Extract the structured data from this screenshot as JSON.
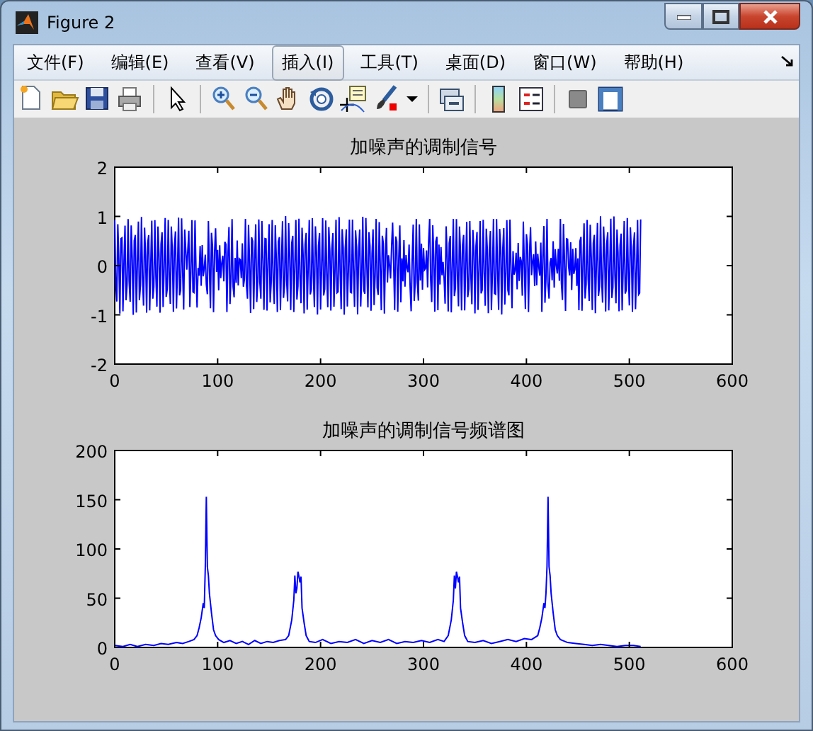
{
  "window": {
    "title": "Figure 2"
  },
  "menu": [
    {
      "label": "文件(F)",
      "selected": false
    },
    {
      "label": "编辑(E)",
      "selected": false
    },
    {
      "label": "查看(V)",
      "selected": false
    },
    {
      "label": "插入(I)",
      "selected": true
    },
    {
      "label": "工具(T)",
      "selected": false
    },
    {
      "label": "桌面(D)",
      "selected": false
    },
    {
      "label": "窗口(W)",
      "selected": false
    },
    {
      "label": "帮助(H)",
      "selected": false
    }
  ],
  "axes": [
    {
      "title": "加噪声的调制信号",
      "kind": "signal",
      "xticks": [
        "0",
        "100",
        "200",
        "300",
        "400",
        "500",
        "600"
      ],
      "yticks": [
        "2",
        "1",
        "0",
        "-1",
        "-2"
      ]
    },
    {
      "kind": "spectrum",
      "chart_data": {
        "type": "line",
        "title": "加噪声的调制信号频谱图",
        "xlim": [
          0,
          600
        ],
        "ylim": [
          0,
          200
        ],
        "xticks": [
          0,
          100,
          200,
          300,
          400,
          500,
          600
        ],
        "yticks": [
          0,
          50,
          100,
          150,
          200
        ],
        "x": [
          0,
          8,
          15,
          22,
          30,
          38,
          45,
          52,
          60,
          66,
          72,
          77,
          80,
          82,
          84,
          86,
          87,
          88,
          89,
          90,
          91,
          92,
          94,
          96,
          98,
          101,
          106,
          112,
          118,
          124,
          130,
          136,
          142,
          148,
          154,
          160,
          166,
          169,
          172,
          174,
          175,
          176,
          177,
          178,
          179,
          180,
          181,
          182,
          184,
          186,
          189,
          195,
          202,
          210,
          218,
          226,
          234,
          242,
          250,
          258,
          266,
          274,
          282,
          290,
          298,
          306,
          314,
          320,
          324,
          327,
          329,
          330,
          331,
          332,
          333,
          334,
          335,
          336,
          338,
          340,
          343,
          350,
          358,
          366,
          374,
          382,
          390,
          398,
          405,
          411,
          413,
          415,
          417,
          418,
          419,
          420,
          421,
          422,
          423,
          424,
          426,
          428,
          430,
          433,
          440,
          448,
          456,
          464,
          472,
          480,
          488,
          496,
          504,
          511
        ],
        "series": [
          {
            "color": "#0000ff",
            "values": [
              2,
              1,
              3,
              1,
              3,
              2,
              4,
              3,
              5,
              4,
              6,
              8,
              12,
              20,
              30,
              45,
              40,
              82,
              153,
              82,
              73,
              55,
              35,
              18,
              12,
              8,
              5,
              7,
              4,
              6,
              3,
              7,
              4,
              6,
              5,
              7,
              8,
              12,
              28,
              48,
              73,
              55,
              60,
              77,
              72,
              66,
              72,
              40,
              25,
              12,
              6,
              5,
              8,
              4,
              6,
              5,
              8,
              4,
              7,
              5,
              8,
              4,
              6,
              5,
              7,
              5,
              8,
              6,
              12,
              28,
              48,
              73,
              60,
              77,
              72,
              66,
              72,
              40,
              25,
              12,
              6,
              5,
              7,
              4,
              6,
              8,
              6,
              9,
              8,
              12,
              20,
              30,
              45,
              40,
              55,
              82,
              153,
              82,
              73,
              55,
              35,
              18,
              12,
              8,
              5,
              4,
              3,
              2,
              3,
              2,
              1,
              2,
              2,
              1
            ]
          }
        ]
      }
    }
  ]
}
